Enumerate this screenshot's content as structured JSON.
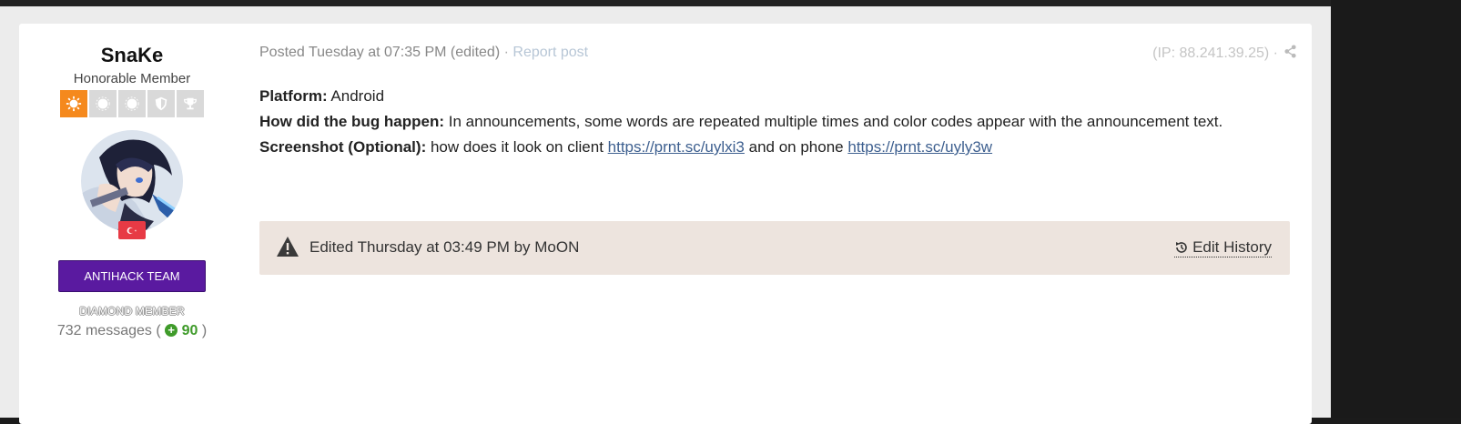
{
  "author": {
    "username": "SnaKe",
    "title": "Honorable Member",
    "badges": [
      {
        "icon": "sun-badge-icon",
        "active": true
      },
      {
        "icon": "circle-badge-icon",
        "active": false
      },
      {
        "icon": "circle-badge-icon",
        "active": false
      },
      {
        "icon": "shield-badge-icon",
        "active": false
      },
      {
        "icon": "trophy-badge-icon",
        "active": false
      }
    ],
    "avatar_icon": "anime-character-avatar",
    "flag_icon": "turkey-flag-icon",
    "group_label": "ANTIHACK TEAM",
    "rank": "DIAMOND MEMBER",
    "messages_prefix": "732 messages (",
    "reputation": "90",
    "messages_suffix": ")"
  },
  "post": {
    "posted": "Posted Tuesday at 07:35 PM (edited)",
    "separator": "·",
    "report_label": "Report post",
    "ip": "(IP: 88.241.39.25) ·",
    "platform_label": "Platform:",
    "platform_value": "Android",
    "bug_label": "How did the bug happen:",
    "bug_value": "In announcements, some words are repeated multiple times and color codes appear with the announcement text.",
    "screenshot_label": "Screenshot (Optional):",
    "screenshot_text1": "how does it look on client",
    "link1": "https://prnt.sc/uylxi3",
    "screenshot_text2": "and on phone",
    "link2": "https://prnt.sc/uyly3w"
  },
  "edit": {
    "text": "Edited Thursday at 03:49 PM by MoON",
    "history_label": "Edit History"
  },
  "colors": {
    "accent_orange": "#f5891d",
    "group_purple": "#5a1aa0",
    "reputation_green": "#3f9b2a",
    "link_blue": "#3d5f8f",
    "edit_box_bg": "#ede4de"
  }
}
